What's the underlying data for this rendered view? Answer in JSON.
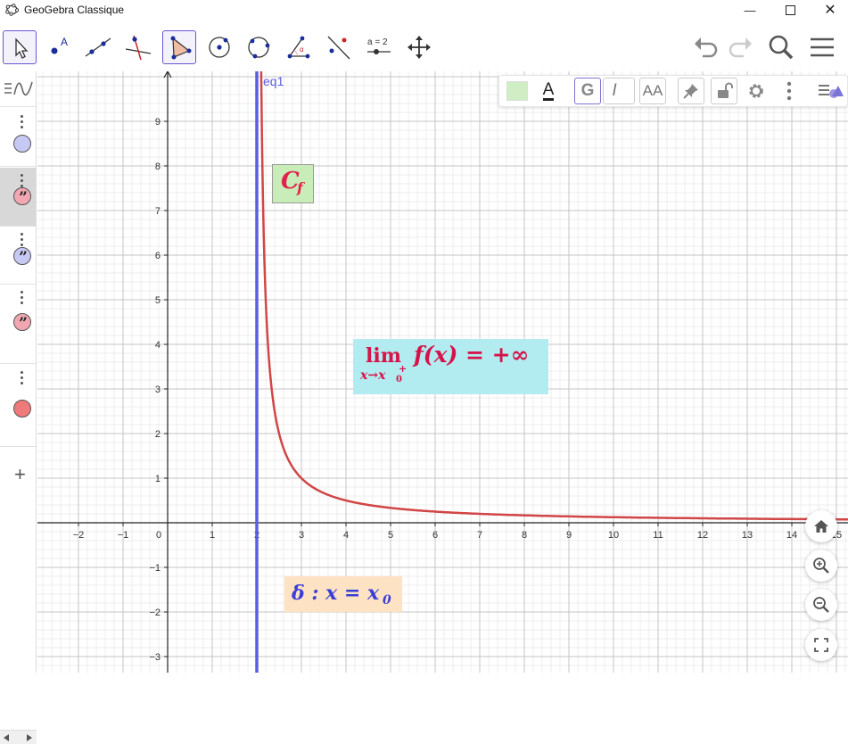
{
  "window": {
    "title": "GeoGebra Classique"
  },
  "toolbar": {
    "tools": [
      "move",
      "point",
      "line",
      "perpendicular-line",
      "polygon",
      "circle-center-point",
      "circle-through-three-points",
      "angle",
      "reflect",
      "slider",
      "move-graphics-view"
    ],
    "slider_label": "a = 2",
    "point_label": "A"
  },
  "stylebar": {
    "text_color_label": "A",
    "bold_label": "G",
    "italic_label": "I",
    "size_label": "AA",
    "fill_color": "#cfeec4"
  },
  "graphics": {
    "x_ticks": [
      "−2",
      "−1",
      "0",
      "1",
      "2",
      "3",
      "4",
      "5",
      "6",
      "7",
      "8",
      "9",
      "10",
      "11",
      "12",
      "13",
      "14",
      "15"
    ],
    "y_ticks_pos": [
      "1",
      "2",
      "3",
      "4",
      "5",
      "6",
      "7",
      "8",
      "9"
    ],
    "y_ticks_neg": [
      "−1",
      "−2",
      "−3"
    ],
    "asymptote_label": "eq1",
    "curve_label_main": "C",
    "curve_label_sub": "f",
    "limit_main": "lim",
    "limit_sub": "x→x",
    "limit_sub_0": "0",
    "limit_sub_plus": "+",
    "limit_expr": "f(x) = +∞",
    "delta_text": "δ : x = x",
    "delta_sub": "0",
    "colors": {
      "curve": "#d14646",
      "asymptote": "#5a5ee0",
      "curve_label": "#e0234e",
      "curve_label_bg": "#c9edb8",
      "limit_text": "#d6134a",
      "limit_bg": "#b3ecf0",
      "delta_text": "#3a3fd6",
      "delta_bg": "#fde2c4"
    }
  }
}
